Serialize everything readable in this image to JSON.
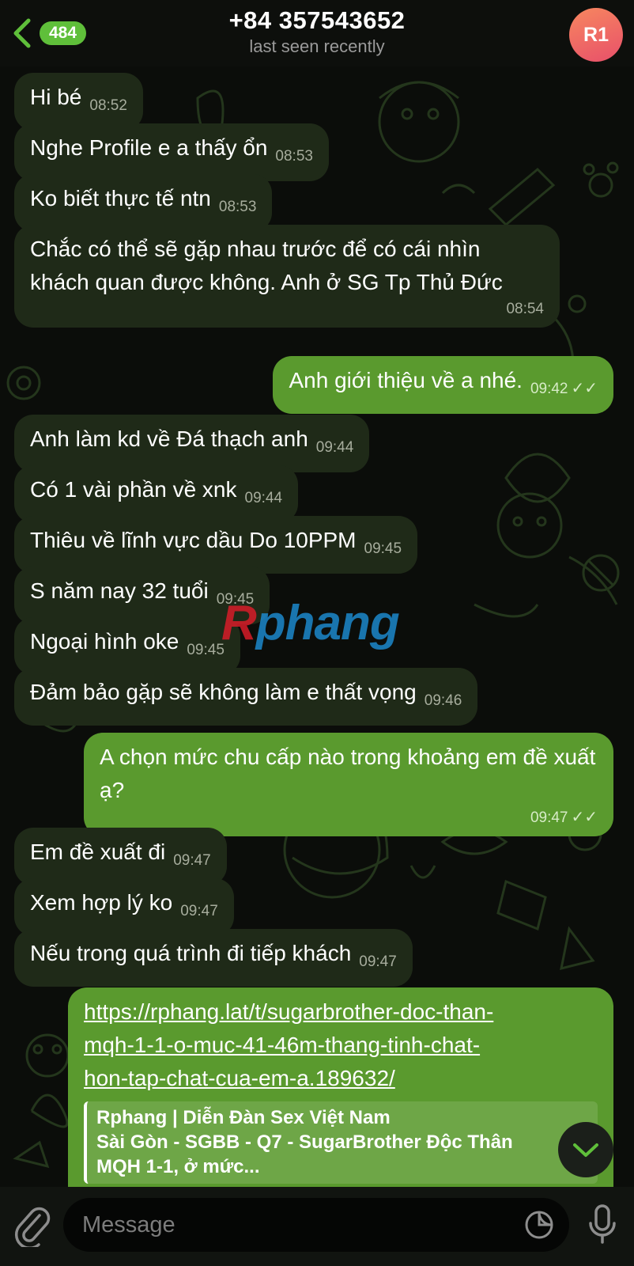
{
  "header": {
    "unread_count": "484",
    "title": "+84 357543652",
    "status": "last seen recently",
    "avatar_initials": "R1",
    "avatar_colors": [
      "#f7875f",
      "#e8506a"
    ]
  },
  "messages": [
    {
      "dir": "in",
      "text": "Hi bé",
      "time": "08:52"
    },
    {
      "dir": "in",
      "text": "Nghe Profile e a thấy ổn",
      "time": "08:53"
    },
    {
      "dir": "in",
      "text": "Ko biết thực tế ntn",
      "time": "08:53"
    },
    {
      "dir": "in",
      "text": "Chắc có thể sẽ gặp nhau trước để có cái nhìn khách quan được không. Anh ở SG Tp Thủ Đức",
      "time": "08:54"
    },
    {
      "dir": "out",
      "text": "Anh giới thiệu về a nhé.",
      "time": "09:42",
      "read": true
    },
    {
      "dir": "in",
      "text": "Anh làm kd về Đá thạch anh",
      "time": "09:44"
    },
    {
      "dir": "in",
      "text": "Có 1 vài phần về xnk",
      "time": "09:44"
    },
    {
      "dir": "in",
      "text": "Thiêu về lĩnh vực dầu Do 10PPM",
      "time": "09:45"
    },
    {
      "dir": "in",
      "text": "S năm nay 32 tuổi",
      "time": "09:45"
    },
    {
      "dir": "in",
      "text": "Ngoại hình oke",
      "time": "09:45"
    },
    {
      "dir": "in",
      "text": "Đảm bảo gặp sẽ không làm e thất vọng",
      "time": "09:46"
    },
    {
      "dir": "out",
      "text": "A chọn mức chu cấp nào trong khoảng em đề xuất ạ?",
      "time": "09:47",
      "read": true
    },
    {
      "dir": "in",
      "text": "Em đề xuất đi",
      "time": "09:47"
    },
    {
      "dir": "in",
      "text": "Xem hợp lý ko",
      "time": "09:47"
    },
    {
      "dir": "in",
      "text": "Nếu trong quá trình đi tiếp khách",
      "time": "09:47"
    },
    {
      "dir": "out",
      "type": "link",
      "url": "https://rphang.lat/t/sugarbrother-doc-than-mqh-1-1-o-muc-41-46m-thang-tinh-chat-hon-tap-chat-cua-em-a.189632/",
      "url_lines": [
        "https://rphang.lat/t/sugarbrother-doc-than-",
        "mqh-1-1-o-muc-41-46m-thang-tinh-chat-",
        "hon-tap-chat-cua-em-a.189632/"
      ],
      "preview_site": "Rphang | Diễn Đàn Sex Việt Nam",
      "preview_title_lines": [
        "Sài Gòn - SGBB - Q7 - SugarBrother Độc Thân",
        "MQH 1-1, ở mức..."
      ]
    }
  ],
  "watermark": {
    "first": "R",
    "rest": "phang"
  },
  "composer": {
    "placeholder": "Message"
  },
  "colors": {
    "incoming_bubble": "#1f2a18",
    "outgoing_bubble": "#5a9a2e",
    "accent": "#5fbf3a"
  }
}
